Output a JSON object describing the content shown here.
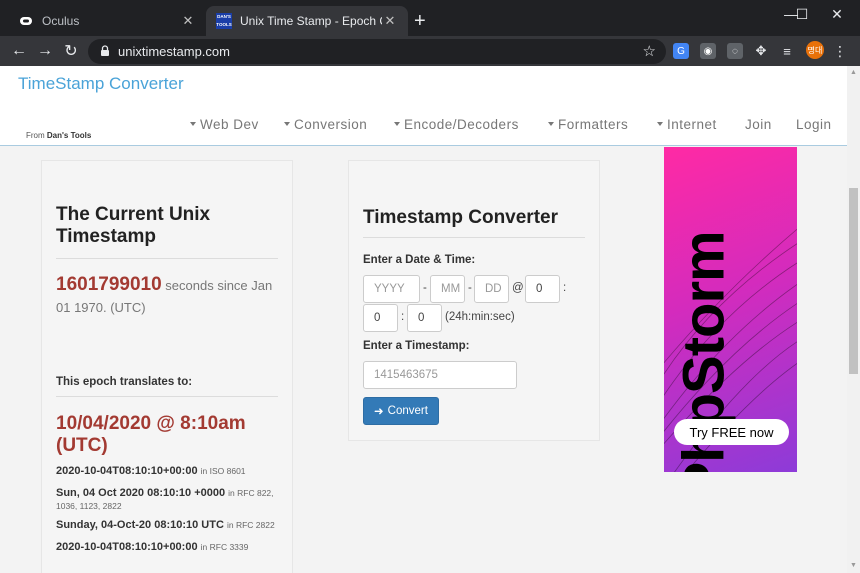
{
  "browser": {
    "tabs": [
      {
        "title": "Oculus",
        "favicon": "oculus-icon"
      },
      {
        "title": "Unix Time Stamp - Epoch Converter",
        "favicon": "dans-tools-icon",
        "favicon_text": "DAN'S TOOLS"
      }
    ],
    "url": "unixtimestamp.com",
    "avatar_text": "명대",
    "ext_translate": "G",
    "window_controls": {
      "minimize": "—",
      "maximize": "☐",
      "close": "✕"
    }
  },
  "site": {
    "brand": "TimeStamp Converter",
    "from_prefix": "From ",
    "from_name": "Dan's Tools",
    "nav": [
      "Web Dev",
      "Conversion",
      "Encode/Decoders",
      "Formatters",
      "Internet",
      "Join",
      "Login"
    ]
  },
  "current": {
    "title": "The Current Unix Timestamp",
    "timestamp": "1601799010",
    "since_text": " seconds since Jan 01 1970. (UTC)",
    "translates_label": "This epoch translates to:",
    "date_human": "10/04/2020 @ 8:10am (UTC)",
    "formats": [
      {
        "value": "2020-10-04T08:10:10+00:00",
        "std": "in ISO 8601"
      },
      {
        "value": "Sun, 04 Oct 2020 08:10:10 +0000",
        "std": "in RFC 822, 1036, 1123, 2822"
      },
      {
        "value": "Sunday, 04-Oct-20 08:10:10 UTC",
        "std": "in RFC 2822"
      },
      {
        "value": "2020-10-04T08:10:10+00:00",
        "std": "in RFC 3339"
      }
    ]
  },
  "converter": {
    "title": "Timestamp Converter",
    "date_label": "Enter a Date & Time:",
    "year_placeholder": "YYYY",
    "month_placeholder": "MM",
    "day_placeholder": "DD",
    "hour_value": "0",
    "minute_value": "0",
    "second_value": "0",
    "time_hint": "(24h:min:sec)",
    "timestamp_label": "Enter a Timestamp:",
    "timestamp_placeholder": "1415463675",
    "convert_label": "Convert"
  },
  "ad": {
    "word": "PhpStorm",
    "cta": "Try FREE now"
  }
}
